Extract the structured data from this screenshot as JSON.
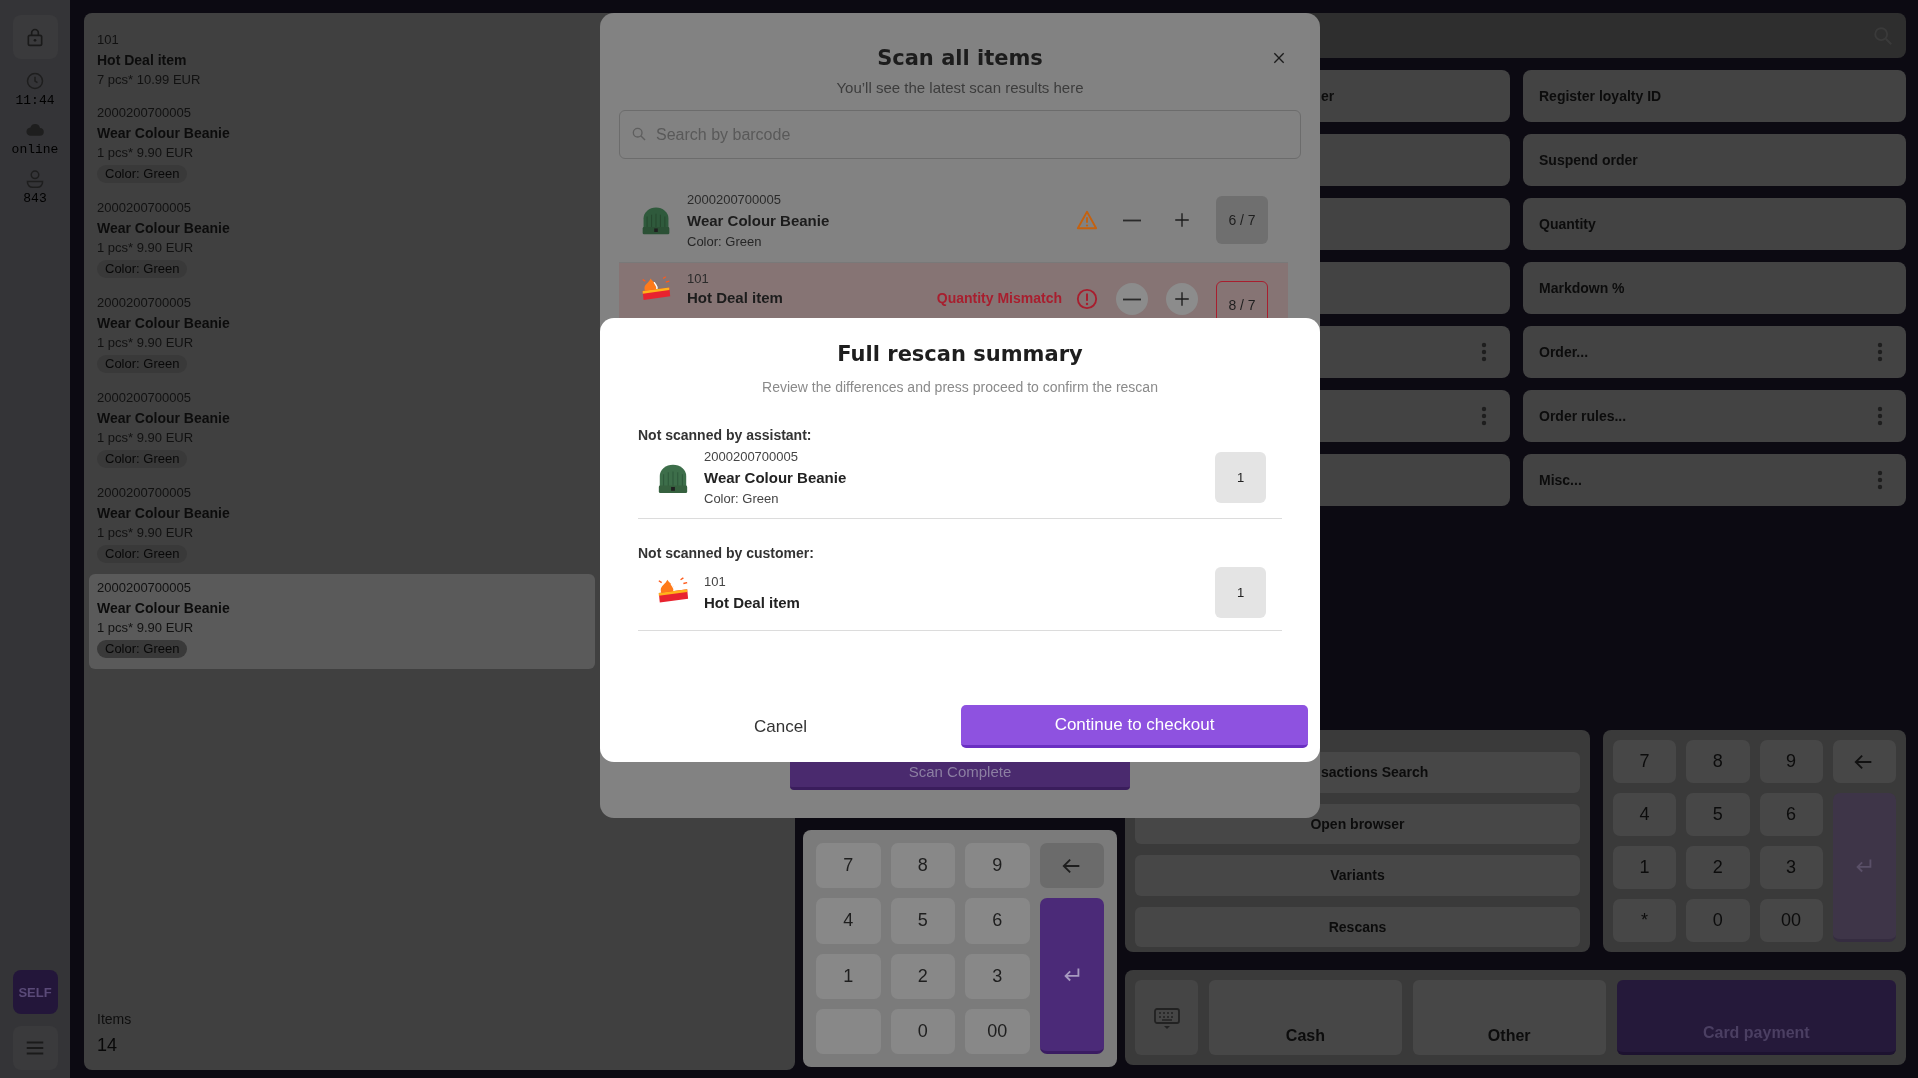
{
  "sidebar": {
    "time": "11:44",
    "connection": "online",
    "user_id": "843",
    "mode_button": "SELF"
  },
  "order": {
    "items": [
      {
        "code": "101",
        "name": "Hot Deal item",
        "price": "7 pcs* 10.99 EUR",
        "selected": false
      },
      {
        "code": "2000200700005",
        "name": "Wear Colour Beanie",
        "price": "1 pcs* 9.90 EUR",
        "variant": "Color: Green",
        "selected": false
      },
      {
        "code": "2000200700005",
        "name": "Wear Colour Beanie",
        "price": "1 pcs* 9.90 EUR",
        "variant": "Color: Green",
        "selected": false
      },
      {
        "code": "2000200700005",
        "name": "Wear Colour Beanie",
        "price": "1 pcs* 9.90 EUR",
        "variant": "Color: Green",
        "selected": false
      },
      {
        "code": "2000200700005",
        "name": "Wear Colour Beanie",
        "price": "1 pcs* 9.90 EUR",
        "variant": "Color: Green",
        "selected": false
      },
      {
        "code": "2000200700005",
        "name": "Wear Colour Beanie",
        "price": "1 pcs* 9.90 EUR",
        "variant": "Color: Green",
        "selected": false
      },
      {
        "code": "2000200700005",
        "name": "Wear Colour Beanie",
        "price": "1 pcs* 9.90 EUR",
        "variant": "Color: Green",
        "selected": true
      }
    ],
    "items_label": "Items",
    "items_count": "14"
  },
  "actions": {
    "buttons": [
      {
        "label": "er",
        "more": false
      },
      {
        "label": "Register loyalty ID",
        "more": false
      },
      {
        "more": false
      },
      {
        "label": "Suspend order",
        "more": false
      },
      {
        "more": false
      },
      {
        "label": "Quantity",
        "more": false
      },
      {
        "more": false
      },
      {
        "label": "Markdown %",
        "more": false
      },
      {
        "more": true
      },
      {
        "label": "Order...",
        "more": true
      },
      {
        "more": true
      },
      {
        "label": "Order rules...",
        "more": true
      },
      {
        "more": false
      },
      {
        "label": "Misc...",
        "more": true
      }
    ]
  },
  "functions": [
    "sactions Search",
    "Open browser",
    "Variants",
    "Rescans"
  ],
  "side_keypad": {
    "keys": [
      {
        "kind": "digit",
        "label": "7"
      },
      {
        "kind": "digit",
        "label": "8"
      },
      {
        "kind": "digit",
        "label": "9"
      },
      {
        "kind": "backspace"
      },
      {
        "kind": "digit",
        "label": "4"
      },
      {
        "kind": "digit",
        "label": "5"
      },
      {
        "kind": "digit",
        "label": "6"
      },
      {
        "kind": "enter"
      },
      {
        "kind": "digit",
        "label": "1"
      },
      {
        "kind": "digit",
        "label": "2"
      },
      {
        "kind": "digit",
        "label": "3"
      },
      {
        "kind": "digit",
        "label": "*"
      },
      {
        "kind": "digit",
        "label": "0"
      },
      {
        "kind": "digit",
        "label": "00"
      }
    ]
  },
  "payment": {
    "buttons": [
      {
        "kind": "keyboard"
      },
      {
        "kind": "plain",
        "label": "Cash"
      },
      {
        "kind": "plain",
        "label": "Other"
      },
      {
        "kind": "primary",
        "label": "Card payment"
      }
    ]
  },
  "scan_modal": {
    "title": "Scan all items",
    "subtitle": "You’ll see the latest scan results here",
    "search": {
      "placeholder": "Search by barcode"
    },
    "rows": [
      {
        "kind": "warning",
        "code": "2000200700005",
        "name": "Wear Colour Beanie",
        "variant": "Color: Green",
        "count": "6 / 7"
      },
      {
        "kind": "mismatch",
        "code": "101",
        "name": "Hot Deal item",
        "status_text": "Quantity Mismatch",
        "count": "8 / 7"
      }
    ],
    "complete_button": "Scan Complete"
  },
  "keypad": {
    "keys": [
      {
        "kind": "digit",
        "label": "7"
      },
      {
        "kind": "digit",
        "label": "8"
      },
      {
        "kind": "digit",
        "label": "9"
      },
      {
        "kind": "backspace"
      },
      {
        "kind": "digit",
        "label": "4"
      },
      {
        "kind": "digit",
        "label": "5"
      },
      {
        "kind": "digit",
        "label": "6"
      },
      {
        "kind": "enter"
      },
      {
        "kind": "digit",
        "label": "1"
      },
      {
        "kind": "digit",
        "label": "2"
      },
      {
        "kind": "digit",
        "label": "3"
      },
      {
        "kind": "blank"
      },
      {
        "kind": "digit",
        "label": "0"
      },
      {
        "kind": "digit",
        "label": "00"
      }
    ]
  },
  "summary": {
    "title": "Full rescan summary",
    "subtitle": "Review the differences and press proceed to confirm the rescan",
    "sections": [
      {
        "heading": "Not scanned by assistant:",
        "items": [
          {
            "code": "2000200700005",
            "name": "Wear Colour Beanie",
            "variant": "Color: Green",
            "count": "1"
          }
        ]
      },
      {
        "heading": "Not scanned by customer:",
        "items": [
          {
            "code": "101",
            "name": "Hot Deal item",
            "count": "1"
          }
        ]
      }
    ],
    "cancel": "Cancel",
    "confirm": "Continue to checkout"
  }
}
